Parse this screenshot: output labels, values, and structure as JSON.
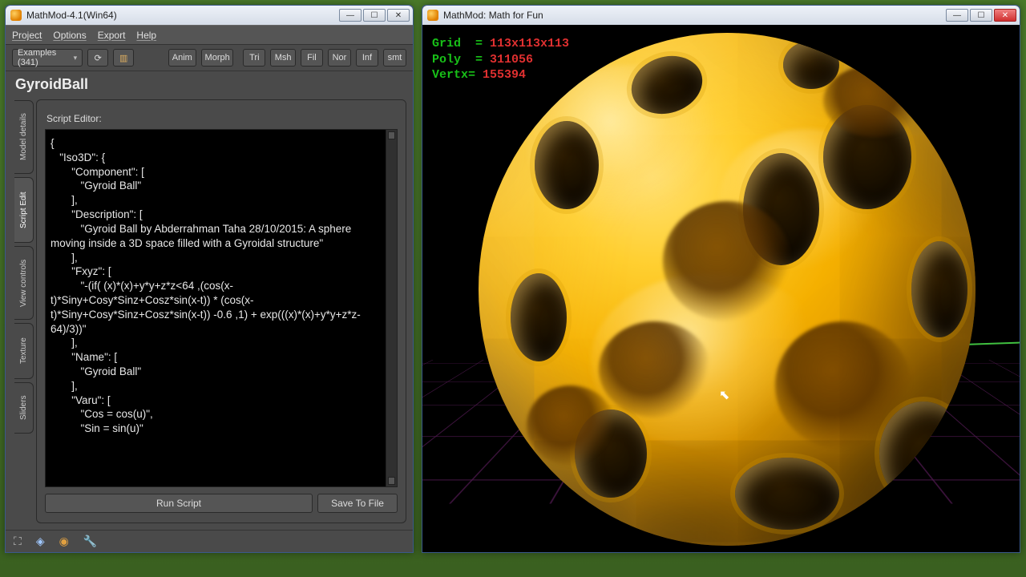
{
  "left_window": {
    "title": "MathMod-4.1(Win64)",
    "menu": {
      "project": "Project",
      "options": "Options",
      "export": "Export",
      "help": "Help"
    },
    "toolbar": {
      "examples_label": "Examples (341)",
      "buttons_mid": {
        "anim": "Anim",
        "morph": "Morph"
      },
      "buttons_right": {
        "tri": "Tri",
        "msh": "Msh",
        "fil": "Fil",
        "nor": "Nor",
        "inf": "Inf",
        "smt": "smt"
      }
    },
    "object_name": "GyroidBall",
    "tabs": {
      "model_details": "Model details",
      "script_edit": "Script Edit",
      "view_controls": "View controls",
      "texture": "Texture",
      "sliders": "Sliders"
    },
    "script": {
      "section_label": "Script Editor:",
      "text": "{\n   \"Iso3D\": {\n       \"Component\": [\n          \"Gyroid Ball\"\n       ],\n       \"Description\": [\n          \"Gyroid Ball by Abderrahman Taha 28/10/2015: A sphere moving inside a 3D space filled with a Gyroidal structure\"\n       ],\n       \"Fxyz\": [\n          \"-(if( (x)*(x)+y*y+z*z<64 ,(cos(x-t)*Siny+Cosy*Sinz+Cosz*sin(x-t)) * (cos(x-t)*Siny+Cosy*Sinz+Cosz*sin(x-t)) -0.6 ,1) + exp(((x)*(x)+y*y+z*z-64)/3))\"\n       ],\n       \"Name\": [\n          \"Gyroid Ball\"\n       ],\n       \"Varu\": [\n          \"Cos = cos(u)\",\n          \"Sin = sin(u)\"",
      "run_label": "Run Script",
      "save_label": "Save To File"
    }
  },
  "right_window": {
    "title": "MathMod: Math for Fun",
    "hud": {
      "grid_label": "Grid  = ",
      "grid_value": "113x113x113",
      "poly_label": "Poly  = ",
      "poly_value": "311056",
      "vert_label": "Vertx= ",
      "vert_value": "155394"
    }
  }
}
